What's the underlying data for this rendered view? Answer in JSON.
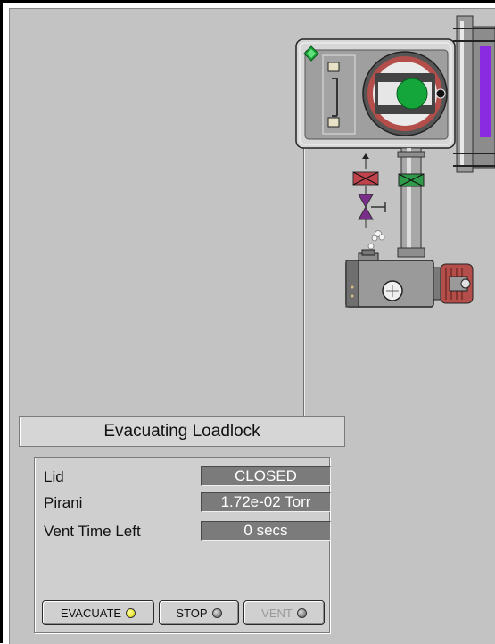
{
  "status": {
    "text": "Evacuating Loadlock"
  },
  "readouts": [
    {
      "label": "Lid",
      "value": "CLOSED"
    },
    {
      "label": "Pirani",
      "value": "1.72e-02 Torr"
    },
    {
      "label": "Vent Time Left",
      "value": "0 secs"
    }
  ],
  "buttons": {
    "evacuate": {
      "label": "EVACUATE",
      "led": "yellow"
    },
    "stop": {
      "label": "STOP",
      "led": "grey"
    },
    "vent": {
      "label": "VENT",
      "led": "grey",
      "enabled": false
    }
  },
  "icons": {
    "chamber_status": "green-diamond-icon",
    "door": "green-door-indicator-icon",
    "valve_vent": "red-valve-icon",
    "valve_main": "green-valve-icon",
    "needle_valve": "purple-needle-valve-icon",
    "pump": "vacuum-pump-icon",
    "motor": "pump-motor-icon"
  },
  "colors": {
    "background": "#c3c3c3",
    "readout_bg": "#7b7b7b",
    "valve_closed": "#c0434b",
    "valve_open": "#2f9b4a",
    "status_green": "#1aa336",
    "slot_purple": "#8a2be2"
  }
}
